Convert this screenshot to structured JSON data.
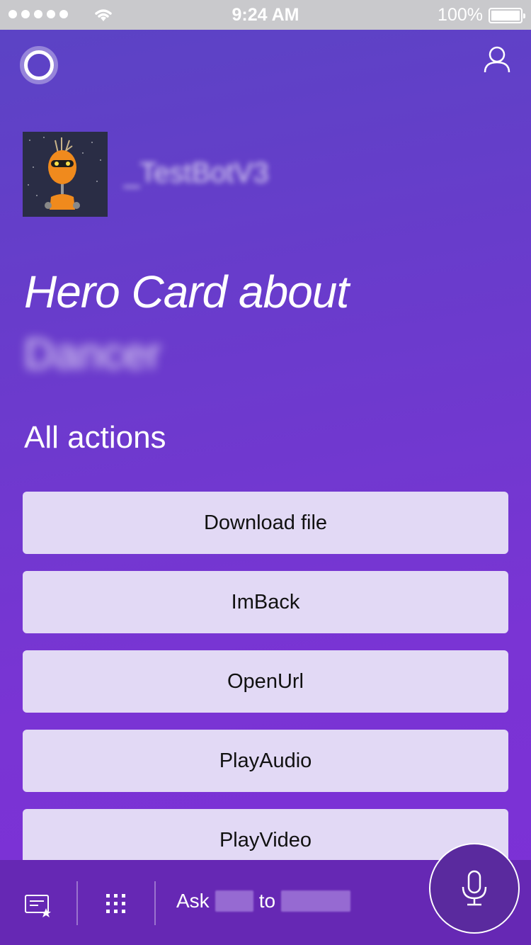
{
  "status_bar": {
    "time": "9:24 AM",
    "battery": "100%",
    "battery_level": 1.0
  },
  "header": {
    "assistant_icon": "cortana-ring-icon",
    "profile_icon": "person-icon"
  },
  "bot": {
    "name": "_TestBotV3"
  },
  "card": {
    "title": "Hero Card about",
    "subtitle": "Dancer"
  },
  "actions": {
    "label": "All actions",
    "buttons": [
      {
        "label": "Download file"
      },
      {
        "label": "ImBack"
      },
      {
        "label": "OpenUrl"
      },
      {
        "label": "PlayAudio"
      },
      {
        "label": "PlayVideo"
      }
    ]
  },
  "bottom_bar": {
    "ask_prefix": "Ask",
    "ask_middle": "to",
    "notebook_icon": "notebook-star-icon",
    "apps_icon": "grid-icon",
    "mic_icon": "microphone-icon"
  },
  "colors": {
    "background": "#6a3bcc",
    "button": "#e2d9f5",
    "bottom_bar": "#6628b4"
  }
}
